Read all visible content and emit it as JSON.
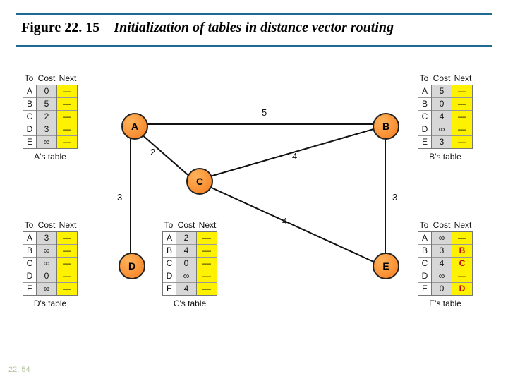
{
  "title": {
    "fignum": "Figure 22. 15",
    "caption": "Initialization of tables in distance vector routing"
  },
  "pagenum": "22. 54",
  "headers": {
    "to": "To",
    "cost": "Cost",
    "next": "Next"
  },
  "nodeLabels": {
    "A": "A",
    "B": "B",
    "C": "C",
    "D": "D",
    "E": "E"
  },
  "tables": {
    "A": {
      "caption": "A's table",
      "to": [
        "A",
        "B",
        "C",
        "D",
        "E"
      ],
      "cost": [
        "0",
        "5",
        "2",
        "3",
        "∞"
      ],
      "next": [
        "—",
        "—",
        "—",
        "—",
        "—"
      ]
    },
    "B": {
      "caption": "B's table",
      "to": [
        "A",
        "B",
        "C",
        "D",
        "E"
      ],
      "cost": [
        "5",
        "0",
        "4",
        "∞",
        "3"
      ],
      "next": [
        "—",
        "—",
        "—",
        "—",
        "—"
      ]
    },
    "C": {
      "caption": "C's table",
      "to": [
        "A",
        "B",
        "C",
        "D",
        "E"
      ],
      "cost": [
        "2",
        "4",
        "0",
        "∞",
        "4"
      ],
      "next": [
        "—",
        "—",
        "—",
        "—",
        "—"
      ]
    },
    "D": {
      "caption": "D's table",
      "to": [
        "A",
        "B",
        "C",
        "D",
        "E"
      ],
      "cost": [
        "3",
        "∞",
        "∞",
        "0",
        "∞"
      ],
      "next": [
        "—",
        "—",
        "—",
        "—",
        "—"
      ]
    },
    "E": {
      "caption": "E's table",
      "to": [
        "A",
        "B",
        "C",
        "D",
        "E"
      ],
      "cost": [
        "∞",
        "3",
        "4",
        "∞",
        "0"
      ],
      "next": [
        "—",
        "B",
        "C",
        "—",
        "D"
      ],
      "nextRedIdx": [
        1,
        2,
        4
      ]
    }
  },
  "edges": {
    "AB": "5",
    "AC": "2",
    "AD": "3",
    "BC": "4",
    "BE": "3",
    "CE": "4"
  }
}
